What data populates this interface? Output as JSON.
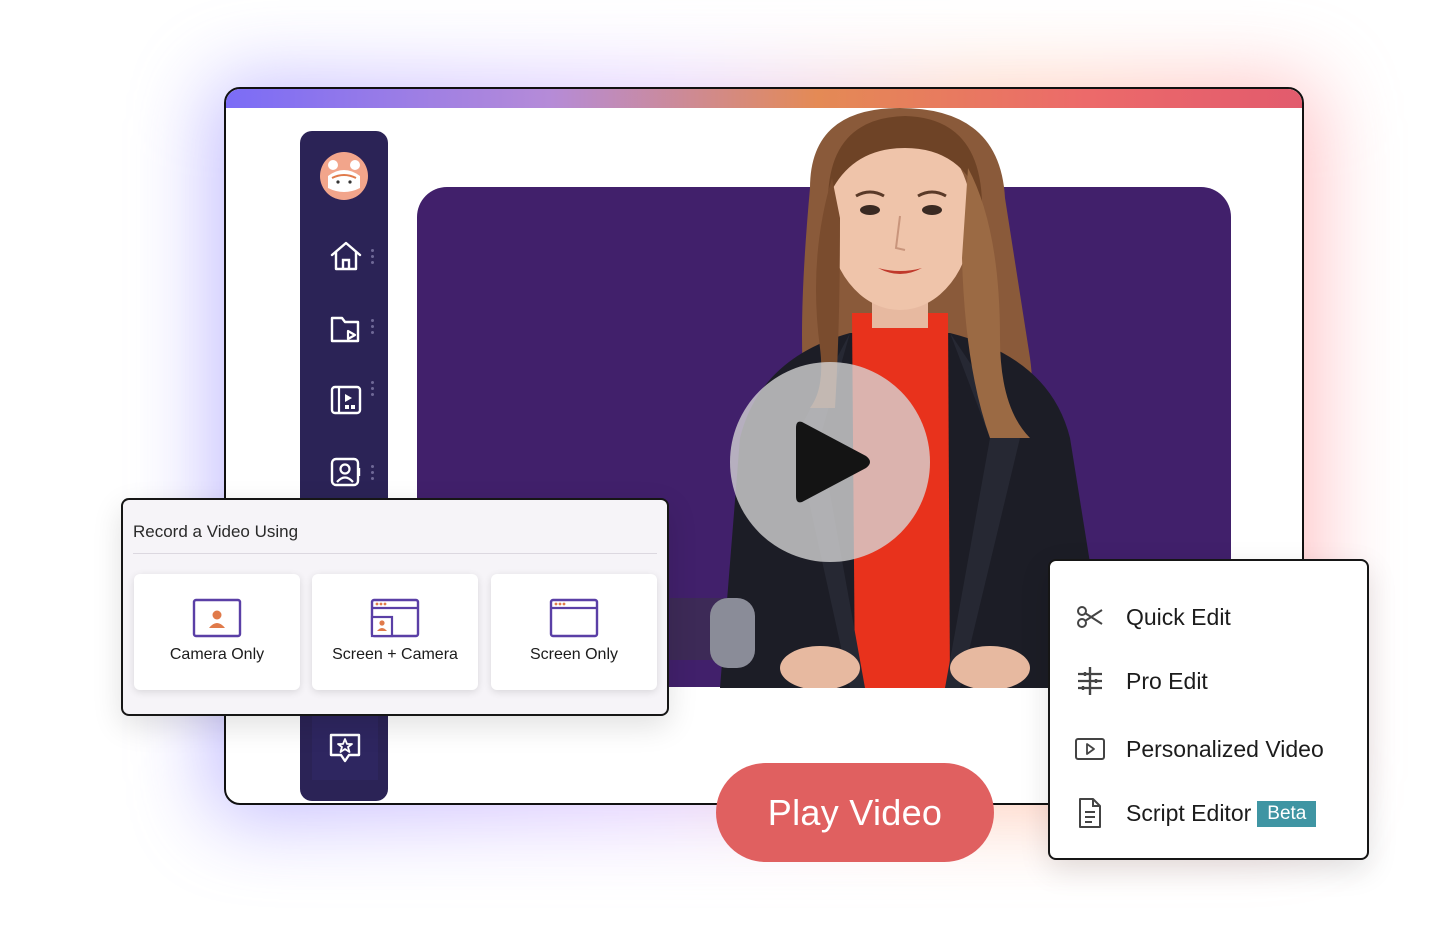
{
  "record_panel": {
    "title": "Record a Video Using",
    "options": [
      {
        "label": "Camera Only",
        "icon": "camera-only-icon"
      },
      {
        "label": "Screen + Camera",
        "icon": "screen-camera-icon"
      },
      {
        "label": "Screen Only",
        "icon": "screen-only-icon"
      }
    ]
  },
  "edit_menu": {
    "items": [
      {
        "label": "Quick Edit",
        "icon": "scissors-icon"
      },
      {
        "label": "Pro Edit",
        "icon": "sliders-icon"
      },
      {
        "label": "Personalized Video",
        "icon": "video-play-icon"
      },
      {
        "label": "Script Editor",
        "icon": "document-icon",
        "badge": "Beta"
      }
    ]
  },
  "play_button": {
    "label": "Play Video"
  },
  "sidebar": {
    "items": [
      {
        "icon": "home-icon"
      },
      {
        "icon": "video-folder-icon"
      },
      {
        "icon": "video-library-icon"
      },
      {
        "icon": "contact-icon"
      },
      {
        "icon": "feedback-star-icon"
      }
    ]
  },
  "colors": {
    "sidebar": "#2b2356",
    "video_background": "#41206b",
    "accent_icon": "#e07a4a",
    "icon_purple": "#5a3fa6",
    "play_button": "#e06060",
    "beta_badge": "#3f95a3"
  }
}
